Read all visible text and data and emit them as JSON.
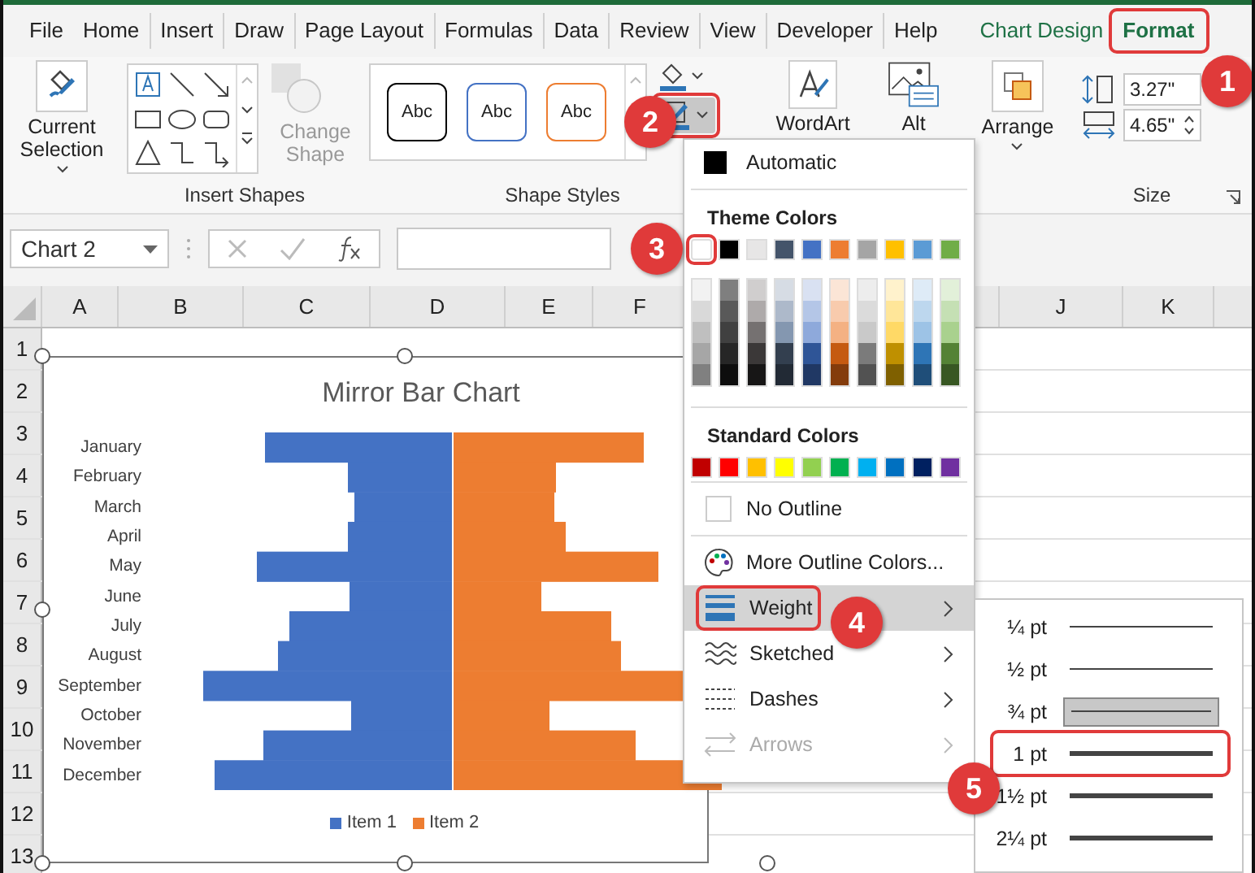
{
  "tabs": [
    {
      "label": "File",
      "selected": false,
      "kind": "core",
      "highlighted": false
    },
    {
      "label": "Home",
      "selected": false,
      "kind": "core",
      "highlighted": false
    },
    {
      "label": "Insert",
      "selected": false,
      "kind": "core",
      "highlighted": false
    },
    {
      "label": "Draw",
      "selected": false,
      "kind": "core",
      "highlighted": false
    },
    {
      "label": "Page Layout",
      "selected": false,
      "kind": "core",
      "highlighted": false
    },
    {
      "label": "Formulas",
      "selected": false,
      "kind": "core",
      "highlighted": false
    },
    {
      "label": "Data",
      "selected": false,
      "kind": "core",
      "highlighted": false
    },
    {
      "label": "Review",
      "selected": false,
      "kind": "core",
      "highlighted": false
    },
    {
      "label": "View",
      "selected": false,
      "kind": "core",
      "highlighted": false
    },
    {
      "label": "Developer",
      "selected": false,
      "kind": "core",
      "highlighted": false
    },
    {
      "label": "Help",
      "selected": false,
      "kind": "core",
      "highlighted": false
    },
    {
      "label": "Chart Design",
      "selected": false,
      "kind": "contextual",
      "highlighted": false
    },
    {
      "label": "Format",
      "selected": true,
      "kind": "contextual",
      "highlighted": true
    }
  ],
  "ribbon": {
    "current_selection": {
      "label": "Current Selection"
    },
    "insert_shapes": {
      "label": "Insert Shapes",
      "change_shape": {
        "label": "Change Shape",
        "disabled": true
      }
    },
    "shape_styles": {
      "label": "Shape Styles",
      "styles": [
        {
          "text": "Abc",
          "color": "#000000"
        },
        {
          "text": "Abc",
          "color": "#4472c4"
        },
        {
          "text": "Abc",
          "color": "#ed7d31"
        }
      ],
      "outline_button": {
        "highlighted": true
      }
    },
    "wordart": {
      "label": "WordArt"
    },
    "alt_text": {
      "label": "Alt"
    },
    "arrange": {
      "label": "Arrange"
    },
    "size": {
      "label": "Size",
      "height": "3.27\"",
      "width": "4.65\""
    }
  },
  "formula_bar": {
    "name_box": "Chart 2"
  },
  "columns": [
    "A",
    "B",
    "C",
    "D",
    "E",
    "F",
    "J",
    "K"
  ],
  "rows": [
    "1",
    "2",
    "3",
    "4",
    "5",
    "6",
    "7",
    "8",
    "9",
    "10",
    "11",
    "12",
    "13"
  ],
  "chart": {
    "title": "Mirror Bar Chart",
    "categories": [
      "January",
      "February",
      "March",
      "April",
      "May",
      "June",
      "July",
      "August",
      "September",
      "October",
      "November",
      "December"
    ],
    "legend": [
      {
        "label": "Item 1",
        "color": "#4472c4"
      },
      {
        "label": "Item 2",
        "color": "#ed7d31"
      }
    ]
  },
  "outline_menu": {
    "automatic": {
      "label": "Automatic"
    },
    "theme_heading": "Theme Colors",
    "theme_colors": [
      {
        "color": "#ffffff",
        "highlighted": true,
        "shades": [
          {
            "color": "#f2f2f2"
          },
          {
            "color": "#d9d9d9"
          },
          {
            "color": "#bfbfbf"
          },
          {
            "color": "#a6a6a6"
          },
          {
            "color": "#808080"
          }
        ]
      },
      {
        "color": "#000000",
        "highlighted": false,
        "shades": [
          {
            "color": "#7f7f7f"
          },
          {
            "color": "#595959"
          },
          {
            "color": "#404040"
          },
          {
            "color": "#262626"
          },
          {
            "color": "#0d0d0d"
          }
        ]
      },
      {
        "color": "#e7e6e6",
        "highlighted": false,
        "shades": [
          {
            "color": "#d0cece"
          },
          {
            "color": "#aeaaaa"
          },
          {
            "color": "#757171"
          },
          {
            "color": "#3b3838"
          },
          {
            "color": "#171616"
          }
        ]
      },
      {
        "color": "#44546a",
        "highlighted": false,
        "shades": [
          {
            "color": "#d6dce4"
          },
          {
            "color": "#adb9ca"
          },
          {
            "color": "#8497b0"
          },
          {
            "color": "#333f4f"
          },
          {
            "color": "#222a35"
          }
        ]
      },
      {
        "color": "#4472c4",
        "highlighted": false,
        "shades": [
          {
            "color": "#d9e1f2"
          },
          {
            "color": "#b4c6e7"
          },
          {
            "color": "#8ea9db"
          },
          {
            "color": "#2f5597"
          },
          {
            "color": "#203864"
          }
        ]
      },
      {
        "color": "#ed7d31",
        "highlighted": false,
        "shades": [
          {
            "color": "#fbe5d6"
          },
          {
            "color": "#f8cbad"
          },
          {
            "color": "#f4b183"
          },
          {
            "color": "#c55a11"
          },
          {
            "color": "#843c0c"
          }
        ]
      },
      {
        "color": "#a5a5a5",
        "highlighted": false,
        "shades": [
          {
            "color": "#ededed"
          },
          {
            "color": "#dbdbdb"
          },
          {
            "color": "#c9c9c9"
          },
          {
            "color": "#7b7b7b"
          },
          {
            "color": "#525252"
          }
        ]
      },
      {
        "color": "#ffc000",
        "highlighted": false,
        "shades": [
          {
            "color": "#fff2cc"
          },
          {
            "color": "#ffe699"
          },
          {
            "color": "#ffd966"
          },
          {
            "color": "#bf9000"
          },
          {
            "color": "#7f6000"
          }
        ]
      },
      {
        "color": "#5b9bd5",
        "highlighted": false,
        "shades": [
          {
            "color": "#deebf7"
          },
          {
            "color": "#bdd7ee"
          },
          {
            "color": "#9dc3e6"
          },
          {
            "color": "#2e75b6"
          },
          {
            "color": "#1f4e79"
          }
        ]
      },
      {
        "color": "#70ad47",
        "highlighted": false,
        "shades": [
          {
            "color": "#e2f0d9"
          },
          {
            "color": "#c5e0b4"
          },
          {
            "color": "#a9d18e"
          },
          {
            "color": "#548235"
          },
          {
            "color": "#385723"
          }
        ]
      }
    ],
    "standard_heading": "Standard Colors",
    "standard_colors": [
      {
        "color": "#c00000"
      },
      {
        "color": "#ff0000"
      },
      {
        "color": "#ffc000"
      },
      {
        "color": "#ffff00"
      },
      {
        "color": "#92d050"
      },
      {
        "color": "#00b050"
      },
      {
        "color": "#00b0f0"
      },
      {
        "color": "#0070c0"
      },
      {
        "color": "#002060"
      },
      {
        "color": "#7030a0"
      }
    ],
    "items": [
      {
        "kind": "no-outline",
        "label": "No Outline",
        "submenu": false,
        "disabled": false,
        "selected": false,
        "highlighted": false
      },
      {
        "kind": "more-colors",
        "label": "More Outline Colors...",
        "submenu": false,
        "disabled": false,
        "selected": false,
        "highlighted": false
      },
      {
        "kind": "weight",
        "label": "Weight",
        "submenu": true,
        "disabled": false,
        "selected": true,
        "highlighted": true
      },
      {
        "kind": "sketched",
        "label": "Sketched",
        "submenu": true,
        "disabled": false,
        "selected": false,
        "highlighted": false
      },
      {
        "kind": "dashes",
        "label": "Dashes",
        "submenu": true,
        "disabled": false,
        "selected": false,
        "highlighted": false
      },
      {
        "kind": "arrows",
        "label": "Arrows",
        "submenu": true,
        "disabled": true,
        "selected": false,
        "highlighted": false
      }
    ]
  },
  "weight_menu": [
    {
      "label": "¼ pt",
      "selected": false,
      "highlighted": false
    },
    {
      "label": "½ pt",
      "selected": false,
      "highlighted": false
    },
    {
      "label": "¾ pt",
      "selected": true,
      "highlighted": false
    },
    {
      "label": "1 pt",
      "selected": false,
      "highlighted": true
    },
    {
      "label": "1½ pt",
      "selected": false,
      "highlighted": false
    },
    {
      "label": "2¼ pt",
      "selected": false,
      "highlighted": false
    }
  ],
  "callouts": [
    "1",
    "2",
    "3",
    "4",
    "5"
  ]
}
